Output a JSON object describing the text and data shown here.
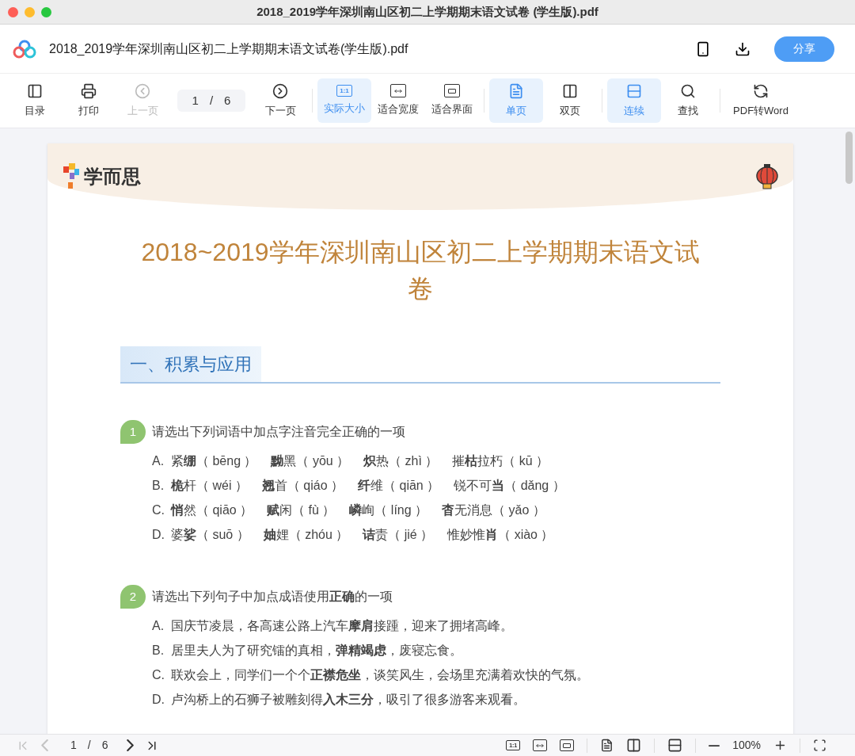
{
  "window": {
    "title": "2018_2019学年深圳南山区初二上学期期末语文试卷 (学生版).pdf"
  },
  "app_bar": {
    "file_name": "2018_2019学年深圳南山区初二上学期期末语文试卷(学生版).pdf",
    "share_label": "分享"
  },
  "toolbar": {
    "items": [
      {
        "kind": "button",
        "label": "目录",
        "disabled": false,
        "selected": false
      },
      {
        "kind": "button",
        "label": "打印",
        "disabled": false,
        "selected": false
      },
      {
        "kind": "button",
        "label": "上一页",
        "disabled": true,
        "selected": false
      },
      {
        "kind": "page",
        "current": "1",
        "separator": "/",
        "total": "6"
      },
      {
        "kind": "button",
        "label": "下一页",
        "disabled": false,
        "selected": false
      },
      {
        "kind": "button",
        "label": "实际大小",
        "icon_text": "1:1",
        "disabled": false,
        "selected": true
      },
      {
        "kind": "button",
        "label": "适合宽度",
        "disabled": false,
        "selected": false
      },
      {
        "kind": "button",
        "label": "适合界面",
        "disabled": false,
        "selected": false
      },
      {
        "kind": "button",
        "label": "单页",
        "disabled": false,
        "selected": true
      },
      {
        "kind": "button",
        "label": "双页",
        "disabled": false,
        "selected": false
      },
      {
        "kind": "button",
        "label": "连续",
        "disabled": false,
        "selected": true
      },
      {
        "kind": "button",
        "label": "查找",
        "disabled": false,
        "selected": false
      },
      {
        "kind": "button",
        "label": "PDF转Word",
        "disabled": false,
        "selected": false
      }
    ]
  },
  "document": {
    "logo_text": "学而思",
    "title": "2018~2019学年深圳南山区初二上学期期末语文试卷",
    "section_heading": "一、积累与应用",
    "questions": [
      {
        "kind": "terms",
        "number": "1",
        "prompt": "请选出下列词语中加点字注音完全正确的一项",
        "options": [
          {
            "letter": "A.",
            "terms": [
              "紧**绷**（ bēng ）",
              "**黝**黑（ yōu ）",
              "**炽**热（ zhì ）",
              "摧**枯**拉朽（ kū ）"
            ]
          },
          {
            "letter": "B.",
            "terms": [
              "**桅**杆（ wéi ）",
              "**翘**首（ qiáo ）",
              "**纤**维（ qiān ）",
              "锐不可**当**（ dǎng ）"
            ]
          },
          {
            "letter": "C.",
            "terms": [
              "**悄**然（ qiāo ）",
              "**赋**闲（ fù ）",
              "**嶙**峋（ líng ）",
              "**杳**无消息（ yǎo ）"
            ]
          },
          {
            "letter": "D.",
            "terms": [
              "婆**娑**（ suō ）",
              "**妯**娌（ zhóu ）",
              "**诘**责（ jié ）",
              "惟妙惟**肖**（ xiào ）"
            ]
          }
        ]
      },
      {
        "kind": "sentences",
        "number": "2",
        "prompt": "请选出下列句子中加点成语使用**正确**的一项",
        "options": [
          {
            "letter": "A.",
            "text": "国庆节凌晨，各高速公路上汽车**摩肩**接踵，迎来了拥堵高峰。"
          },
          {
            "letter": "B.",
            "text": "居里夫人为了研究镭的真相，**弹精竭虑**，废寝忘食。"
          },
          {
            "letter": "C.",
            "text": "联欢会上，同学们一个个**正襟危坐**，谈笑风生，会场里充满着欢快的气氛。"
          },
          {
            "letter": "D.",
            "text": "卢沟桥上的石狮子被雕刻得**入木三分**，吸引了很多游客来观看。"
          }
        ]
      }
    ]
  },
  "status_bar": {
    "nav_buttons": [
      {
        "disabled": true
      },
      {
        "disabled": true
      },
      {
        "disabled": false
      },
      {
        "disabled": false
      }
    ],
    "current_page": "1",
    "separator": "/",
    "total_pages": "6",
    "actual_size_icon_text": "1:1",
    "zoom": "100%"
  }
}
